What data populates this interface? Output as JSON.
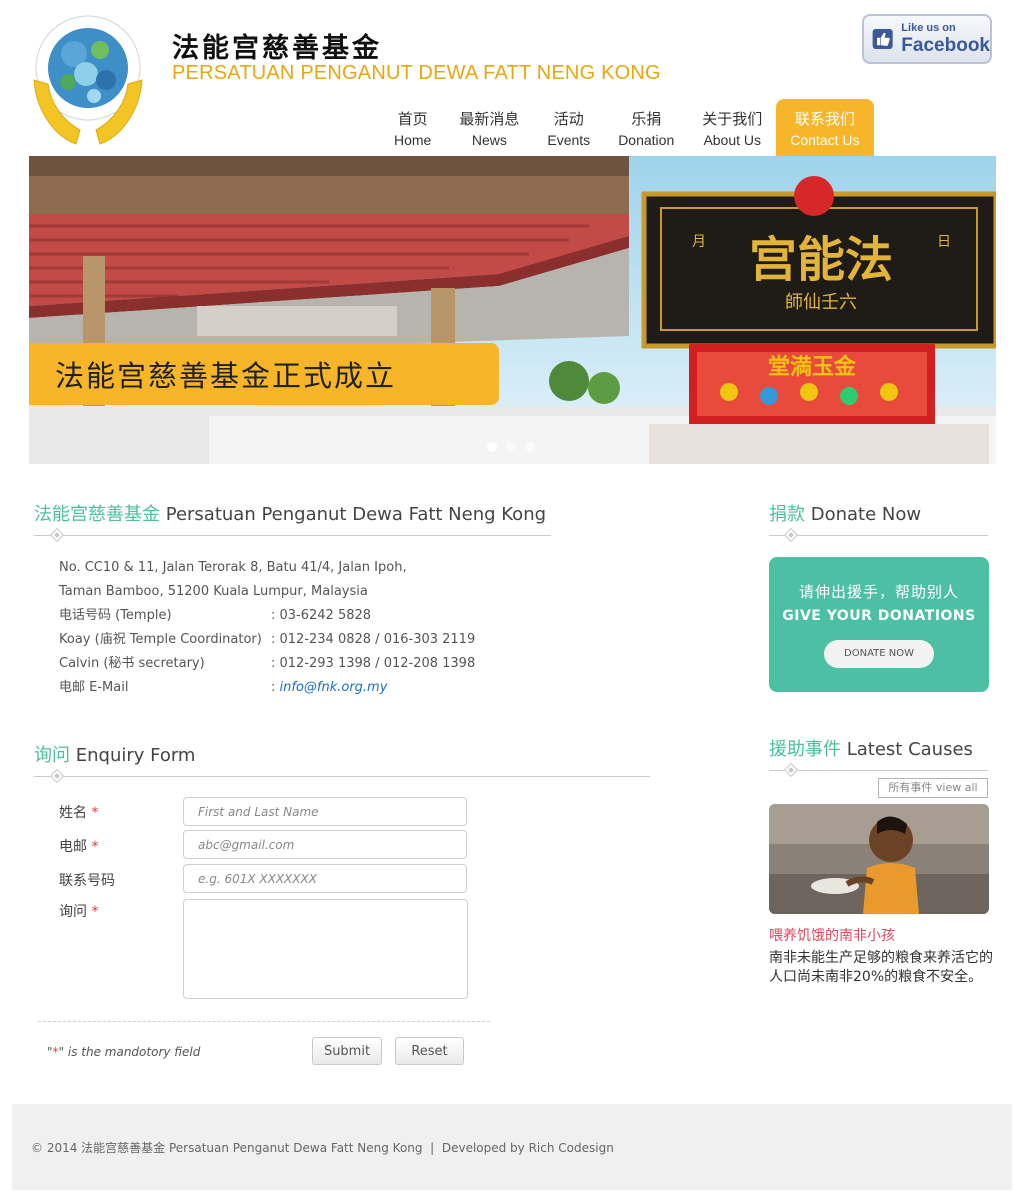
{
  "header": {
    "brand_cn": "法能宫慈善基金",
    "brand_en": "PERSATUAN PENGANUT DEWA FATT NENG KONG",
    "facebook_like": "Like us on",
    "facebook_name": "Facebook"
  },
  "nav": [
    {
      "cn": "首页",
      "en": "Home"
    },
    {
      "cn": "最新消息",
      "en": "News"
    },
    {
      "cn": "活动",
      "en": "Events"
    },
    {
      "cn": "乐捐",
      "en": "Donation"
    },
    {
      "cn": "关于我们",
      "en": "About Us"
    },
    {
      "cn": "联系我们",
      "en": "Contact Us",
      "active": true
    }
  ],
  "banner": {
    "caption": "法能宫慈善基金正式成立",
    "sign_main": "宫能法",
    "sign_sub": "師仙壬六",
    "sign_left": "月",
    "sign_right": "日",
    "red_banner": "堂満玉金",
    "active_slide": 1,
    "slide_count": 3
  },
  "contact": {
    "title_cn": "法能宫慈善基金",
    "title_en": "Persatuan Penganut Dewa Fatt Neng Kong",
    "address1": "No. CC10 & 11, Jalan Terorak 8, Batu 41/4, Jalan Ipoh,",
    "address2": "Taman Bamboo, 51200 Kuala Lumpur, Malaysia",
    "rows": [
      {
        "label": "电话号码 (Temple)",
        "value": ": 03-6242 5828"
      },
      {
        "label": "Koay (庙祝 Temple Coordinator)",
        "value": ": 012-234 0828 / 016-303 2119"
      },
      {
        "label": "Calvin (秘书 secretary)",
        "value": ": 012-293 1398 / 012-208 1398"
      },
      {
        "label": "电邮  E-Mail",
        "value_prefix": ": ",
        "value": "info@fnk.org.my"
      }
    ]
  },
  "enquiry": {
    "title_cn": "询问",
    "title_en": "Enquiry Form",
    "name_label": "姓名",
    "name_placeholder": "First and Last Name",
    "email_label": "电邮",
    "email_placeholder": "abc@gmail.com",
    "phone_label": "联系号码",
    "phone_placeholder": "e.g. 601X XXXXXXX",
    "message_label": "询问",
    "required_mark": "*",
    "note_quote_open": "\"",
    "note_quote_close": "\"",
    "note": " is the mandotory field",
    "submit": "Submit",
    "reset": "Reset"
  },
  "donate": {
    "title_cn": "捐款",
    "title_en": "Donate Now",
    "line_cn": "请伸出援手，帮助别人",
    "line_en": "GIVE YOUR DONATIONS",
    "button": "DONATE NOW",
    "box_color": "#4cbfa5"
  },
  "causes": {
    "title_cn": "援助事件",
    "title_en": "Latest Causes",
    "view_all_cn": "所有事件",
    "view_all_en": "view all",
    "item_title": "喂养饥饿的南非小孩",
    "item_desc": "南非未能生产足够的粮食来养活它的人口尚未南非20%的粮食不安全。"
  },
  "footer": {
    "copyright": "© 2014 法能宫慈善基金  Persatuan Penganut Dewa Fatt Neng Kong",
    "separator": "|",
    "developed": "Developed by Rich Codesign"
  },
  "colors": {
    "accent_yellow": "#f7b52a",
    "accent_teal": "#4cbf9f",
    "required_red": "#e23b3b",
    "cause_title": "#e0475f",
    "link_blue": "#1a6ec9"
  }
}
